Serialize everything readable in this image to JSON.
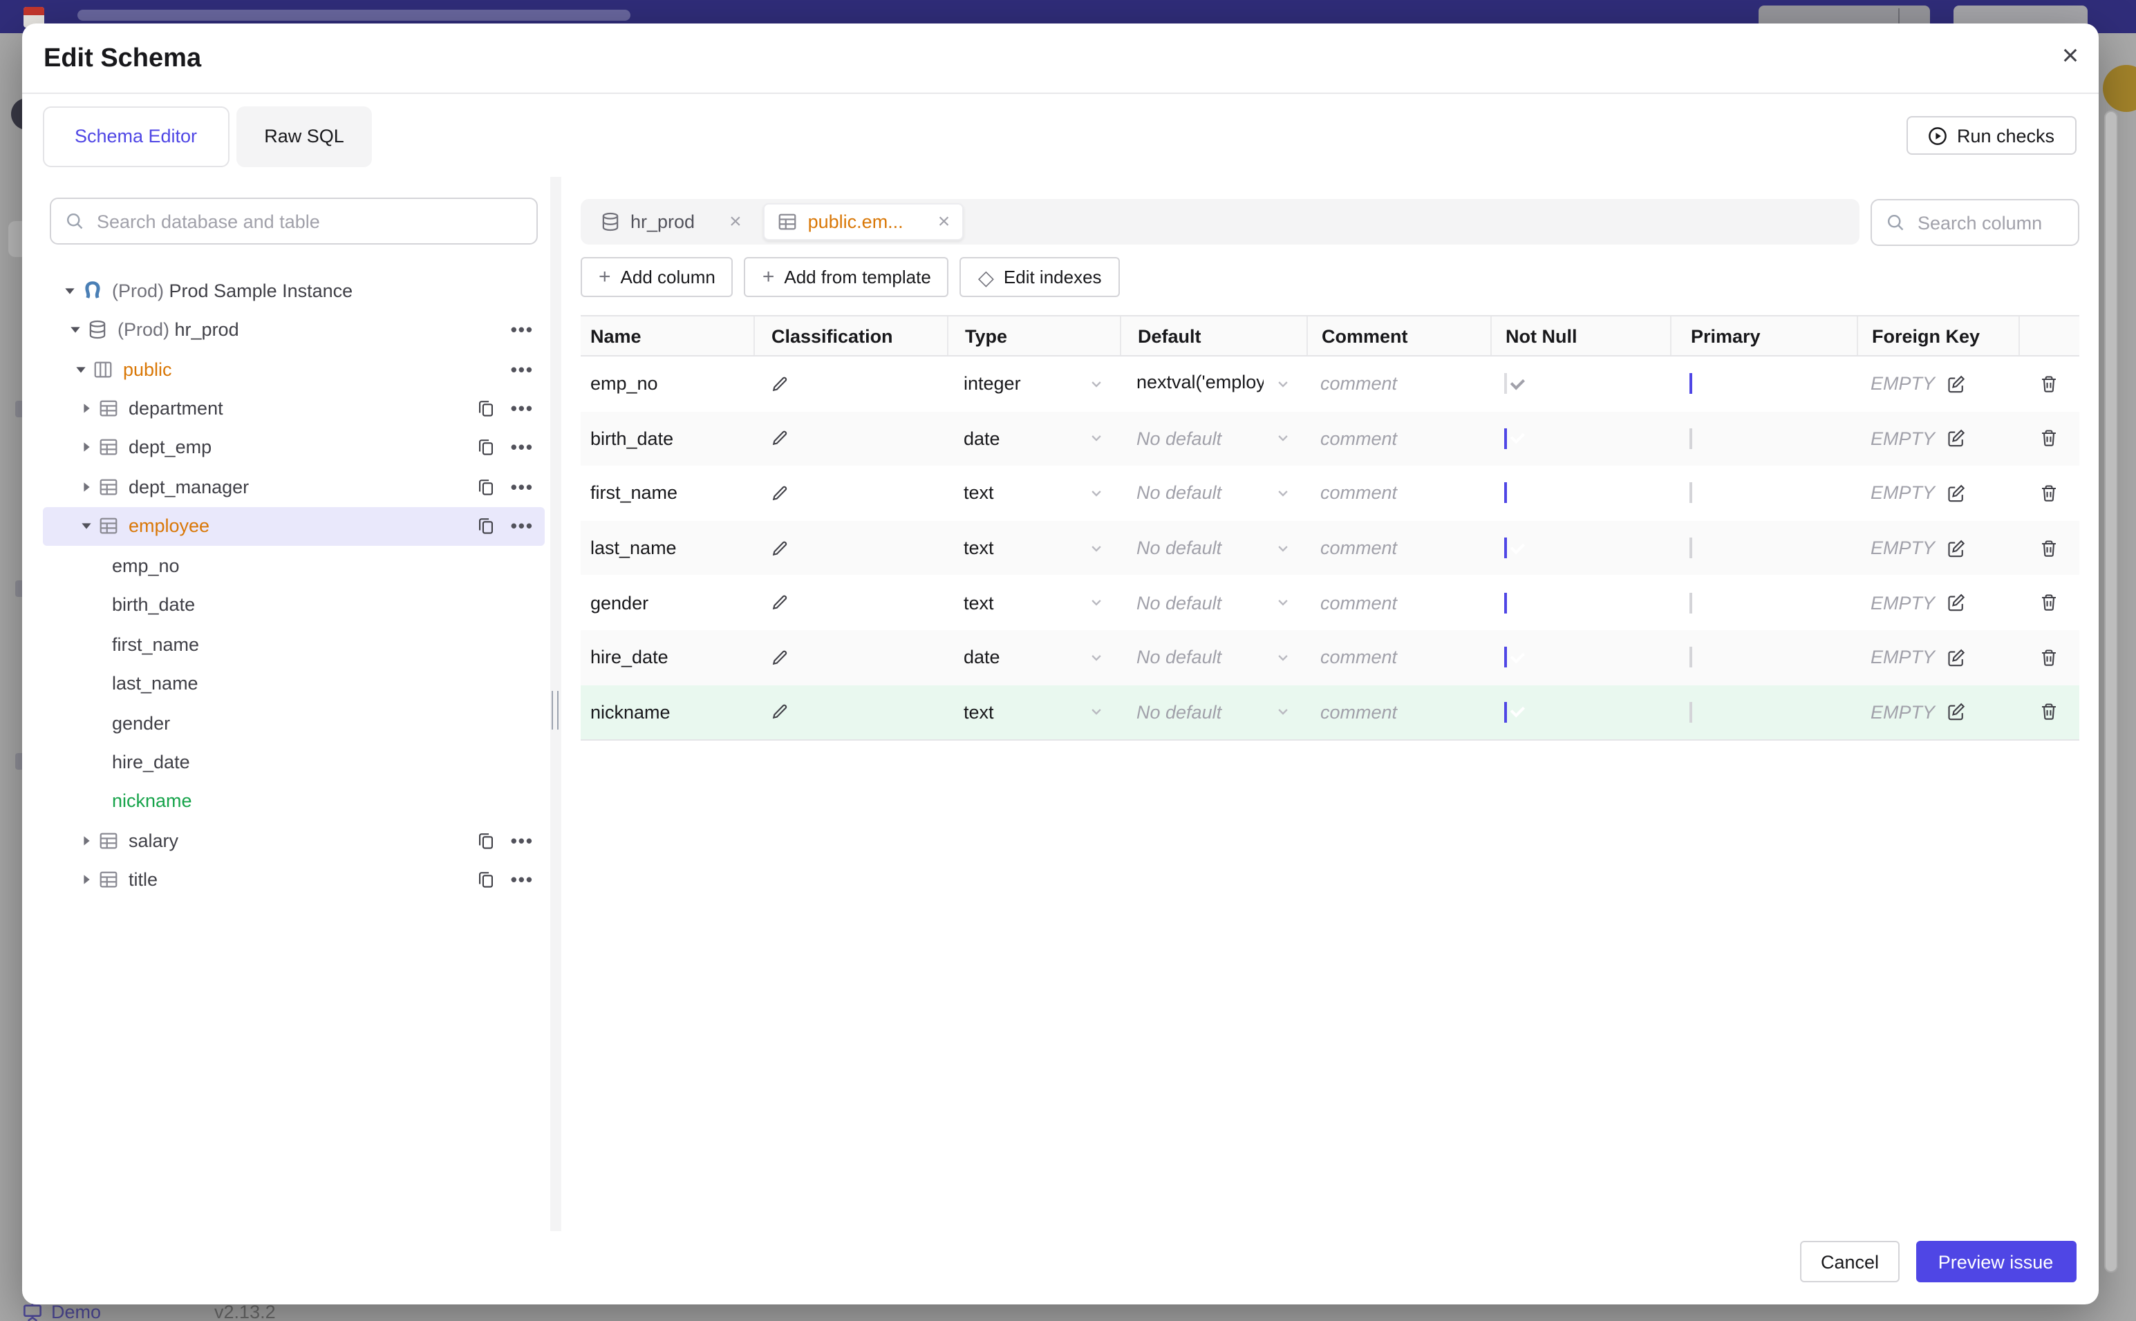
{
  "backdrop": {
    "demo_label": "Demo",
    "version": "v2.13.2",
    "top_bar_color": "#302d7a"
  },
  "modal": {
    "title": "Edit Schema",
    "tabs": [
      {
        "label": "Schema Editor",
        "active": true
      },
      {
        "label": "Raw SQL",
        "active": false
      }
    ],
    "run_checks_label": "Run checks",
    "sidebar": {
      "search_placeholder": "Search database and table",
      "tree": [
        {
          "level": 0,
          "caret": "down",
          "icon": "instance",
          "prefix": "(Prod) ",
          "label": "Prod Sample Instance",
          "color": "default",
          "actions": []
        },
        {
          "level": 1,
          "caret": "down",
          "icon": "database",
          "prefix": "(Prod) ",
          "label": "hr_prod",
          "color": "default",
          "actions": [
            "more"
          ]
        },
        {
          "level": 2,
          "caret": "down",
          "icon": "schema",
          "prefix": "",
          "label": "public",
          "color": "orange",
          "actions": [
            "more"
          ]
        },
        {
          "level": 3,
          "caret": "right",
          "icon": "table",
          "prefix": "",
          "label": "department",
          "color": "default",
          "actions": [
            "copy",
            "more"
          ]
        },
        {
          "level": 3,
          "caret": "right",
          "icon": "table",
          "prefix": "",
          "label": "dept_emp",
          "color": "default",
          "actions": [
            "copy",
            "more"
          ]
        },
        {
          "level": 3,
          "caret": "right",
          "icon": "table",
          "prefix": "",
          "label": "dept_manager",
          "color": "default",
          "actions": [
            "copy",
            "more"
          ]
        },
        {
          "level": 3,
          "caret": "down",
          "icon": "table",
          "prefix": "",
          "label": "employee",
          "color": "orange",
          "selected": true,
          "actions": [
            "copy",
            "more"
          ]
        },
        {
          "level": 4,
          "caret": "none",
          "icon": "none",
          "prefix": "",
          "label": "emp_no",
          "color": "default",
          "actions": []
        },
        {
          "level": 4,
          "caret": "none",
          "icon": "none",
          "prefix": "",
          "label": "birth_date",
          "color": "default",
          "actions": []
        },
        {
          "level": 4,
          "caret": "none",
          "icon": "none",
          "prefix": "",
          "label": "first_name",
          "color": "default",
          "actions": []
        },
        {
          "level": 4,
          "caret": "none",
          "icon": "none",
          "prefix": "",
          "label": "last_name",
          "color": "default",
          "actions": []
        },
        {
          "level": 4,
          "caret": "none",
          "icon": "none",
          "prefix": "",
          "label": "gender",
          "color": "default",
          "actions": []
        },
        {
          "level": 4,
          "caret": "none",
          "icon": "none",
          "prefix": "",
          "label": "hire_date",
          "color": "default",
          "actions": []
        },
        {
          "level": 4,
          "caret": "none",
          "icon": "none",
          "prefix": "",
          "label": "nickname",
          "color": "green",
          "actions": []
        },
        {
          "level": 3,
          "caret": "right",
          "icon": "table",
          "prefix": "",
          "label": "salary",
          "color": "default",
          "actions": [
            "copy",
            "more"
          ]
        },
        {
          "level": 3,
          "caret": "right",
          "icon": "table",
          "prefix": "",
          "label": "title",
          "color": "default",
          "actions": [
            "copy",
            "more"
          ]
        }
      ]
    },
    "editor": {
      "chips": [
        {
          "icon": "database",
          "label": "hr_prod",
          "active": false,
          "label_color": "default"
        },
        {
          "icon": "table",
          "label": "public.em...",
          "active": true,
          "label_color": "orange"
        }
      ],
      "column_search_placeholder": "Search column",
      "toolbar": [
        {
          "glyph": "+",
          "label": "Add column"
        },
        {
          "glyph": "+",
          "label": "Add from template"
        },
        {
          "glyph": "◇",
          "label": "Edit indexes"
        }
      ],
      "table": {
        "headers": [
          "Name",
          "Classification",
          "Type",
          "Default",
          "Comment",
          "Not Null",
          "Primary",
          "Foreign Key",
          ""
        ],
        "comment_placeholder": "comment",
        "no_default_placeholder": "No default",
        "foreign_key_placeholder": "EMPTY",
        "rows": [
          {
            "name": "emp_no",
            "type": "integer",
            "default": "nextval('employ",
            "default_is_value": true,
            "not_null": "checked-disabled",
            "primary": true,
            "highlight": ""
          },
          {
            "name": "birth_date",
            "type": "date",
            "default": "No default",
            "default_is_value": false,
            "not_null": "checked",
            "primary": false,
            "highlight": ""
          },
          {
            "name": "first_name",
            "type": "text",
            "default": "No default",
            "default_is_value": false,
            "not_null": "checked",
            "primary": false,
            "highlight": ""
          },
          {
            "name": "last_name",
            "type": "text",
            "default": "No default",
            "default_is_value": false,
            "not_null": "checked",
            "primary": false,
            "highlight": ""
          },
          {
            "name": "gender",
            "type": "text",
            "default": "No default",
            "default_is_value": false,
            "not_null": "checked",
            "primary": false,
            "highlight": ""
          },
          {
            "name": "hire_date",
            "type": "date",
            "default": "No default",
            "default_is_value": false,
            "not_null": "checked",
            "primary": false,
            "highlight": ""
          },
          {
            "name": "nickname",
            "type": "text",
            "default": "No default",
            "default_is_value": false,
            "not_null": "checked",
            "primary": false,
            "highlight": "added"
          }
        ]
      }
    },
    "footer": {
      "cancel_label": "Cancel",
      "submit_label": "Preview issue"
    }
  },
  "colors": {
    "accent": "#4f46e5",
    "modified_orange": "#d97706",
    "added_green": "#16a34a",
    "added_row_bg": "#e9f8ef",
    "selected_tree_bg": "#e9e8fb"
  }
}
